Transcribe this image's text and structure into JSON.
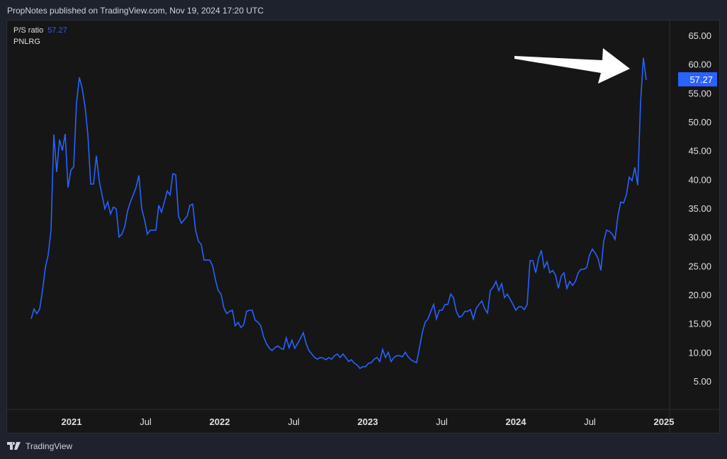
{
  "header": {
    "published": "PropNotes published on TradingView.com, Nov 19, 2024 17:20 UTC"
  },
  "legend": {
    "indicator": "P/S ratio",
    "value": "57.27",
    "symbol": "PNLRG"
  },
  "footer": {
    "brand": "TradingView"
  },
  "colors": {
    "line": "#2962ff",
    "label_bg": "#2962ff",
    "arrow": "#ffffff"
  },
  "chart_data": {
    "type": "line",
    "title": "P/S ratio",
    "series_name": "PNLRG",
    "x_start": "2020-09-27",
    "x_step_days": 7,
    "values": [
      15.8,
      17.5,
      16.7,
      17.5,
      20.7,
      24.7,
      26.9,
      31.2,
      47.8,
      41.3,
      46.9,
      45,
      47.9,
      38.6,
      41.6,
      42.2,
      53.3,
      57.7,
      55.8,
      52.7,
      47.8,
      39.2,
      39.2,
      44.1,
      39.8,
      37.3,
      34.9,
      36.1,
      34,
      35.2,
      34.9,
      30,
      30.5,
      31.8,
      34.5,
      36.1,
      37.3,
      38.6,
      40.7,
      34.9,
      33,
      30.5,
      31.2,
      31.2,
      31.2,
      35.5,
      34.3,
      36.1,
      38,
      37.3,
      41,
      40.8,
      33.6,
      32.4,
      33,
      33.6,
      35.5,
      35.7,
      31.2,
      29.3,
      28.7,
      26,
      26,
      26,
      25,
      22.6,
      20.7,
      20.1,
      17.7,
      16.7,
      17.1,
      17.3,
      14.6,
      15.2,
      14.3,
      14.8,
      17.1,
      17.3,
      17.3,
      15.6,
      15.2,
      14.6,
      12.7,
      11.5,
      10.7,
      10.3,
      10.8,
      11.1,
      10.7,
      10.5,
      12.5,
      10.8,
      12.1,
      10.7,
      11.5,
      12.4,
      13.4,
      11.5,
      10.3,
      9.7,
      9.1,
      8.8,
      9.1,
      9,
      8.7,
      9.1,
      8.8,
      9.4,
      9.7,
      9.1,
      9.7,
      9.1,
      8.4,
      8.7,
      8.1,
      7.8,
      7.2,
      7.5,
      7.5,
      8.1,
      8.2,
      8.8,
      9.1,
      8.4,
      10.5,
      9.1,
      10,
      8.4,
      9.1,
      9.4,
      9.4,
      9.2,
      10,
      9.2,
      8.7,
      8.4,
      8.2,
      10.8,
      13.4,
      15.2,
      15.8,
      17.1,
      18.3,
      15.8,
      17.3,
      17.3,
      18.3,
      18.3,
      20.1,
      19.5,
      17.1,
      16.1,
      16.3,
      17.1,
      17.1,
      17.4,
      15.8,
      17.6,
      18.3,
      18.9,
      17.6,
      16.8,
      20.7,
      21.3,
      22.3,
      20.7,
      21.9,
      19.5,
      20.1,
      19.2,
      18.3,
      17.3,
      17.9,
      17.9,
      17.4,
      18.3,
      25.9,
      25.9,
      23.8,
      26.3,
      27.7,
      24.7,
      25.7,
      23.8,
      24.2,
      23.4,
      21.1,
      23.2,
      23.8,
      21.1,
      22.3,
      21.6,
      22.3,
      23.8,
      24.4,
      24.4,
      24.7,
      26.9,
      27.9,
      27.2,
      26.3,
      24.2,
      29.3,
      31.2,
      31,
      30.5,
      29.6,
      33.6,
      36.1,
      35.9,
      37.3,
      40.4,
      39.8,
      42.1,
      39,
      53.3,
      61.1,
      57.27
    ],
    "last_value_label": "57.27",
    "y_ticks": [
      "65.00",
      "60.00",
      "55.00",
      "50.00",
      "45.00",
      "40.00",
      "35.00",
      "30.00",
      "25.00",
      "20.00",
      "15.00",
      "10.00",
      "5.00"
    ],
    "x_ticks": [
      "2021",
      "Jul",
      "2022",
      "Jul",
      "2023",
      "Jul",
      "2024",
      "Jul",
      "2025"
    ],
    "ylim": [
      5,
      65
    ],
    "grid": false
  }
}
